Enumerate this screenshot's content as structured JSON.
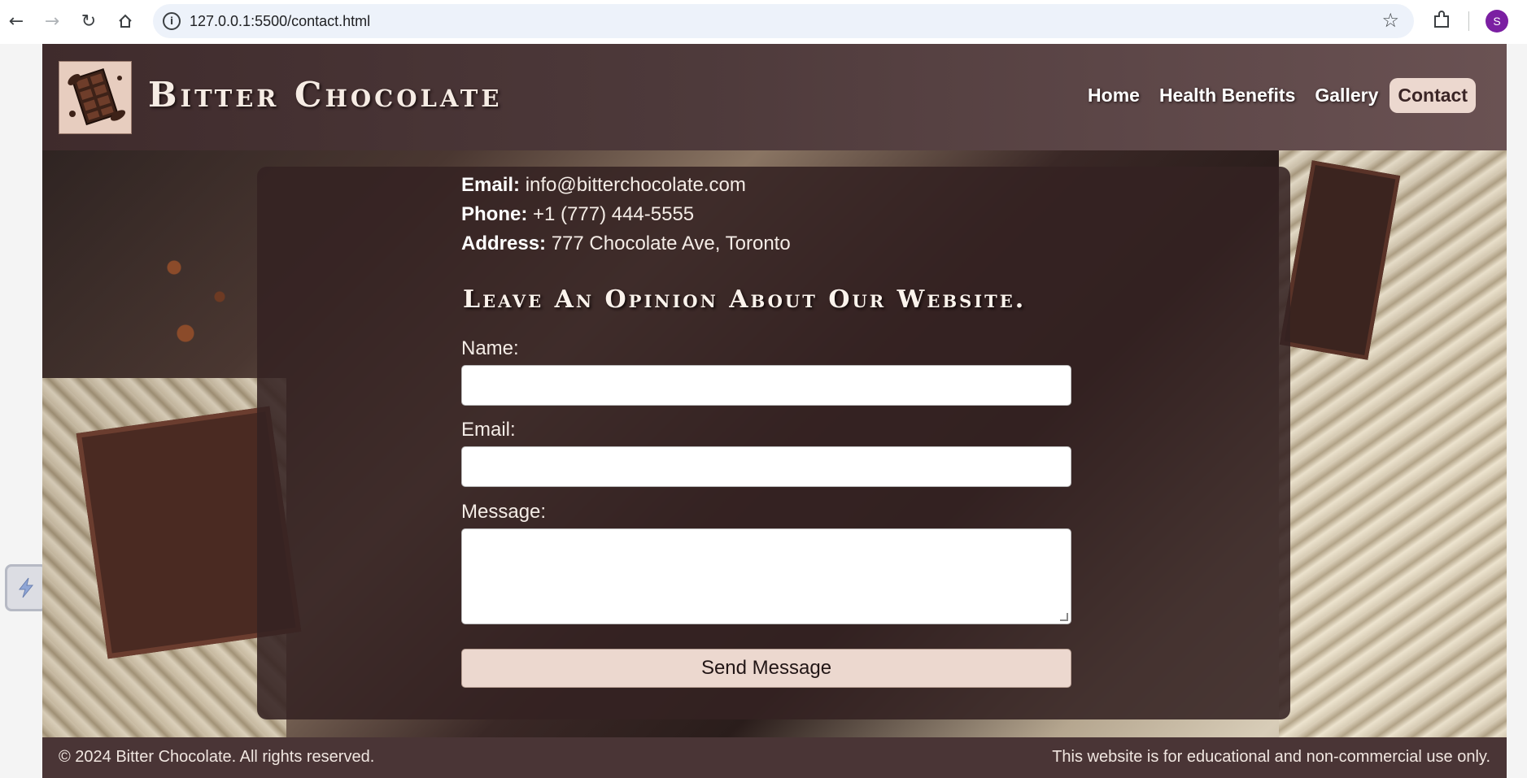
{
  "browser": {
    "url": "127.0.0.1:5500/contact.html",
    "profile_initial": "S",
    "back_icon": "arrow-left-icon",
    "forward_icon": "arrow-right-icon",
    "reload_icon": "reload-icon",
    "home_icon": "home-icon"
  },
  "header": {
    "site_title": "Bitter Chocolate",
    "nav": [
      {
        "label": "Home"
      },
      {
        "label": "Health Benefits"
      },
      {
        "label": "Gallery"
      },
      {
        "label": "Contact",
        "active": true
      }
    ]
  },
  "contact_info": {
    "email_label": "Email:",
    "email_value": " info@bitterchocolate.com",
    "phone_label": "Phone:",
    "phone_value": " +1 (777) 444-5555",
    "address_label": "Address:",
    "address_value": " 777 Chocolate Ave, Toronto"
  },
  "form": {
    "title": "Leave An Opinion About Our Website.",
    "name_label": "Name:",
    "email_label": "Email:",
    "message_label": "Message:",
    "name_value": "",
    "email_value": "",
    "message_value": "",
    "submit_label": "Send Message"
  },
  "footer": {
    "copyright": "© 2024 Bitter Chocolate. All rights reserved.",
    "disclaimer": "This website is for educational and non-commercial use only."
  },
  "colors": {
    "header_bg": "#4e3a3b",
    "accent": "#ecd8cf",
    "panel_bg": "#342222",
    "footer_bg": "#4a3536"
  }
}
